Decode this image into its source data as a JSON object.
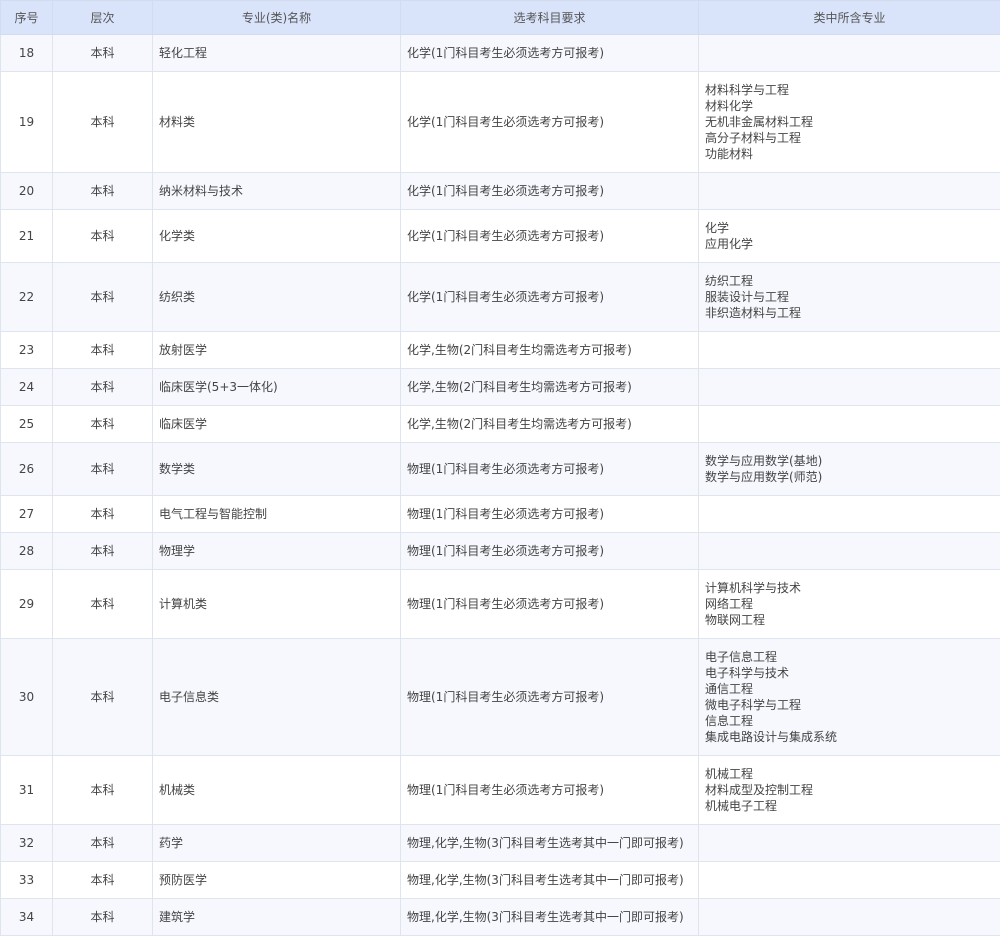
{
  "header": {
    "index": "序号",
    "level": "层次",
    "major": "专业(类)名称",
    "requirement": "选考科目要求",
    "included": "类中所含专业"
  },
  "rows": [
    {
      "index": "18",
      "level": "本科",
      "major": "轻化工程",
      "requirement": "化学(1门科目考生必须选考方可报考)",
      "included": []
    },
    {
      "index": "19",
      "level": "本科",
      "major": "材料类",
      "requirement": "化学(1门科目考生必须选考方可报考)",
      "included": [
        "材料科学与工程",
        "材料化学",
        "无机非金属材料工程",
        "高分子材料与工程",
        "功能材料"
      ]
    },
    {
      "index": "20",
      "level": "本科",
      "major": "纳米材料与技术",
      "requirement": "化学(1门科目考生必须选考方可报考)",
      "included": []
    },
    {
      "index": "21",
      "level": "本科",
      "major": "化学类",
      "requirement": "化学(1门科目考生必须选考方可报考)",
      "included": [
        "化学",
        "应用化学"
      ]
    },
    {
      "index": "22",
      "level": "本科",
      "major": "纺织类",
      "requirement": "化学(1门科目考生必须选考方可报考)",
      "included": [
        "纺织工程",
        "服装设计与工程",
        "非织造材料与工程"
      ]
    },
    {
      "index": "23",
      "level": "本科",
      "major": "放射医学",
      "requirement": "化学,生物(2门科目考生均需选考方可报考)",
      "included": []
    },
    {
      "index": "24",
      "level": "本科",
      "major": "临床医学(5+3一体化)",
      "requirement": "化学,生物(2门科目考生均需选考方可报考)",
      "included": []
    },
    {
      "index": "25",
      "level": "本科",
      "major": "临床医学",
      "requirement": "化学,生物(2门科目考生均需选考方可报考)",
      "included": []
    },
    {
      "index": "26",
      "level": "本科",
      "major": "数学类",
      "requirement": "物理(1门科目考生必须选考方可报考)",
      "included": [
        "数学与应用数学(基地)",
        "数学与应用数学(师范)"
      ]
    },
    {
      "index": "27",
      "level": "本科",
      "major": "电气工程与智能控制",
      "requirement": "物理(1门科目考生必须选考方可报考)",
      "included": []
    },
    {
      "index": "28",
      "level": "本科",
      "major": "物理学",
      "requirement": "物理(1门科目考生必须选考方可报考)",
      "included": []
    },
    {
      "index": "29",
      "level": "本科",
      "major": "计算机类",
      "requirement": "物理(1门科目考生必须选考方可报考)",
      "included": [
        "计算机科学与技术",
        "网络工程",
        "物联网工程"
      ]
    },
    {
      "index": "30",
      "level": "本科",
      "major": "电子信息类",
      "requirement": "物理(1门科目考生必须选考方可报考)",
      "included": [
        "电子信息工程",
        "电子科学与技术",
        "通信工程",
        "微电子科学与工程",
        "信息工程",
        "集成电路设计与集成系统"
      ]
    },
    {
      "index": "31",
      "level": "本科",
      "major": "机械类",
      "requirement": "物理(1门科目考生必须选考方可报考)",
      "included": [
        "机械工程",
        "材料成型及控制工程",
        "机械电子工程"
      ]
    },
    {
      "index": "32",
      "level": "本科",
      "major": "药学",
      "requirement": "物理,化学,生物(3门科目考生选考其中一门即可报考)",
      "included": []
    },
    {
      "index": "33",
      "level": "本科",
      "major": "预防医学",
      "requirement": "物理,化学,生物(3门科目考生选考其中一门即可报考)",
      "included": []
    },
    {
      "index": "34",
      "level": "本科",
      "major": "建筑学",
      "requirement": "物理,化学,生物(3门科目考生选考其中一门即可报考)",
      "included": []
    }
  ]
}
